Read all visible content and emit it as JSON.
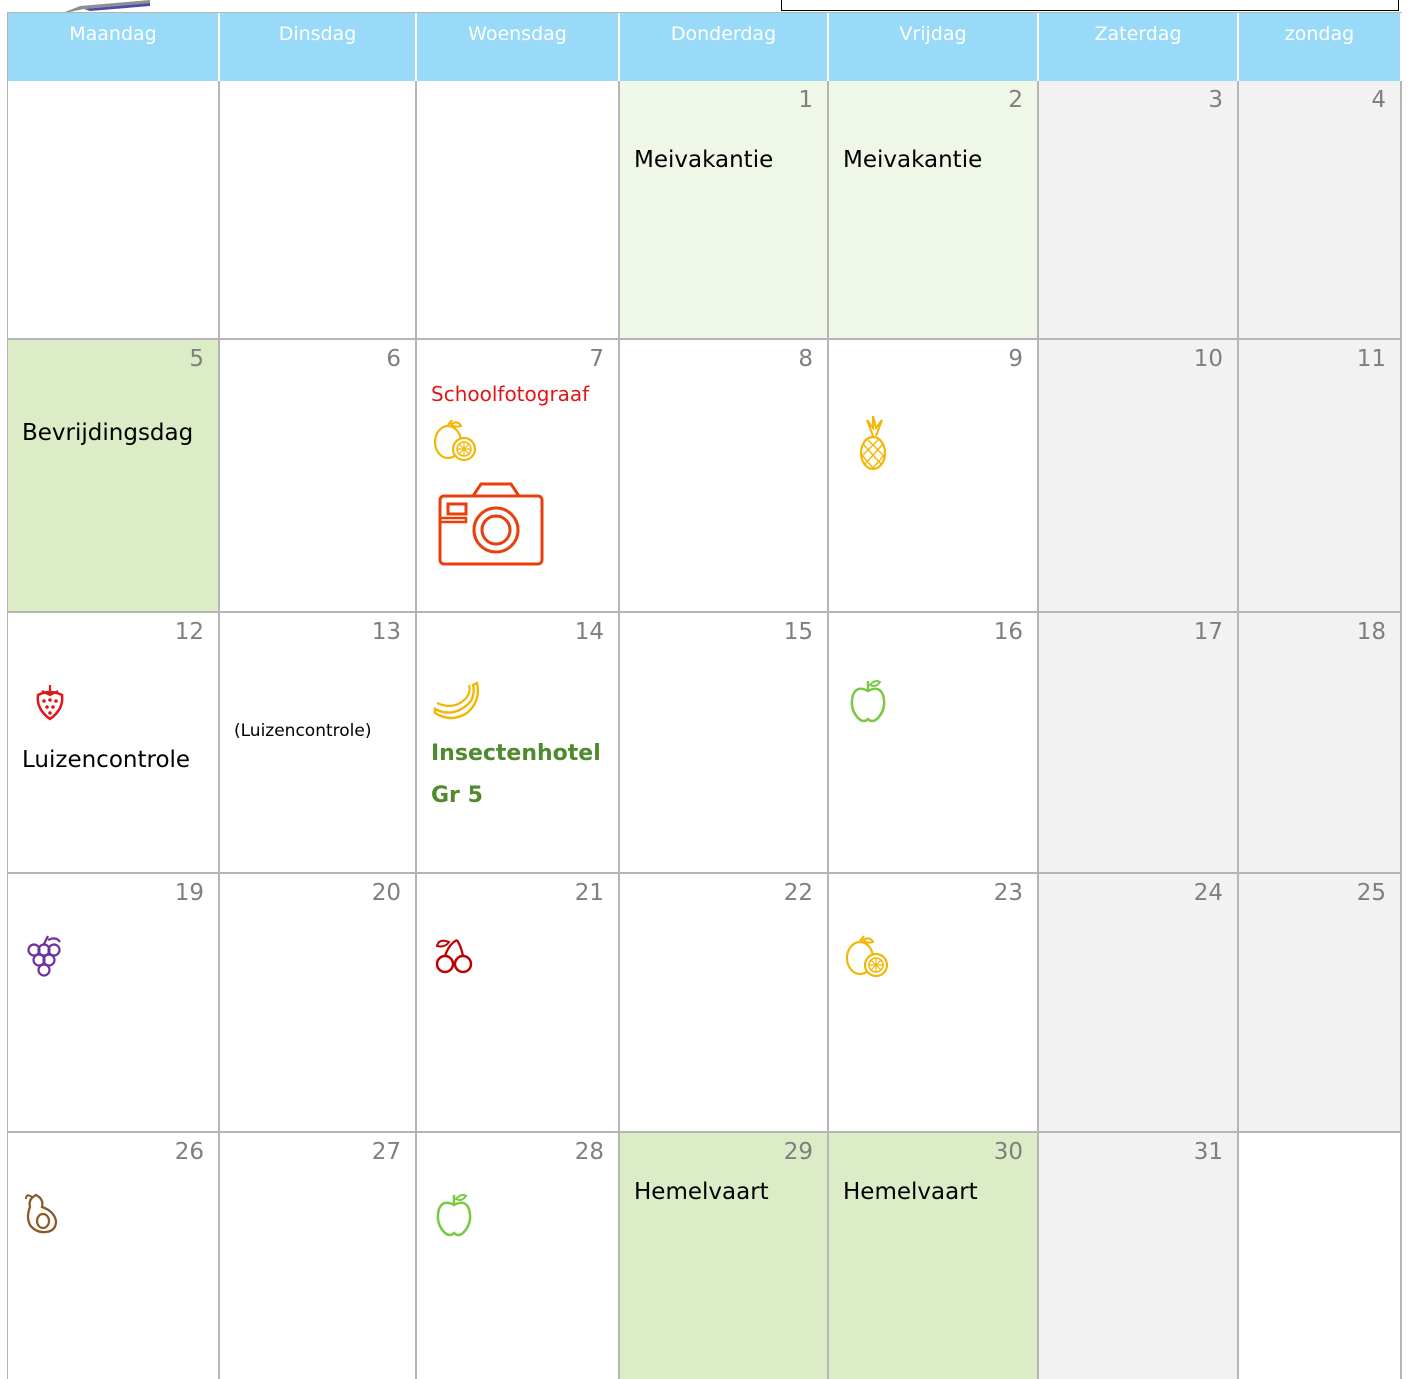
{
  "weekdays": [
    "Maandag",
    "Dinsdag",
    "Woensdag",
    "Donderdag",
    "Vrijdag",
    "Zaterdag",
    "zondag"
  ],
  "weeks": [
    [
      {
        "day": "",
        "type": "normal"
      },
      {
        "day": "",
        "type": "normal"
      },
      {
        "day": "",
        "type": "normal"
      },
      {
        "day": "1",
        "type": "vac-light",
        "events": [
          "Meivakantie"
        ]
      },
      {
        "day": "2",
        "type": "vac-light",
        "events": [
          "Meivakantie"
        ]
      },
      {
        "day": "3",
        "type": "weekend"
      },
      {
        "day": "4",
        "type": "weekend"
      }
    ],
    [
      {
        "day": "5",
        "type": "vac",
        "events": [
          "Bevrijdingsdag"
        ]
      },
      {
        "day": "6",
        "type": "normal"
      },
      {
        "day": "7",
        "type": "normal",
        "events": [
          "Schoolfotograaf"
        ],
        "icons": [
          "lemon-icon",
          "camera-icon"
        ]
      },
      {
        "day": "8",
        "type": "normal"
      },
      {
        "day": "9",
        "type": "normal",
        "icons": [
          "pineapple-icon"
        ]
      },
      {
        "day": "10",
        "type": "weekend"
      },
      {
        "day": "11",
        "type": "weekend"
      }
    ],
    [
      {
        "day": "12",
        "type": "normal",
        "events": [
          "Luizencontrole"
        ],
        "icons": [
          "strawberry-icon"
        ]
      },
      {
        "day": "13",
        "type": "normal",
        "events": [
          "(Luizencontrole)"
        ]
      },
      {
        "day": "14",
        "type": "normal",
        "events": [
          "Insectenhotel",
          "Gr 5"
        ],
        "icons": [
          "banana-icon"
        ]
      },
      {
        "day": "15",
        "type": "normal"
      },
      {
        "day": "16",
        "type": "normal",
        "icons": [
          "apple-icon"
        ]
      },
      {
        "day": "17",
        "type": "weekend"
      },
      {
        "day": "18",
        "type": "weekend"
      }
    ],
    [
      {
        "day": "19",
        "type": "normal",
        "icons": [
          "grapes-icon"
        ]
      },
      {
        "day": "20",
        "type": "normal"
      },
      {
        "day": "21",
        "type": "normal",
        "icons": [
          "cherry-icon"
        ]
      },
      {
        "day": "22",
        "type": "normal"
      },
      {
        "day": "23",
        "type": "normal",
        "icons": [
          "lemon-icon"
        ]
      },
      {
        "day": "24",
        "type": "weekend"
      },
      {
        "day": "25",
        "type": "weekend"
      }
    ],
    [
      {
        "day": "26",
        "type": "normal",
        "icons": [
          "avocado-icon"
        ]
      },
      {
        "day": "27",
        "type": "normal"
      },
      {
        "day": "28",
        "type": "normal",
        "icons": [
          "apple-icon"
        ]
      },
      {
        "day": "29",
        "type": "vac",
        "events": [
          "Hemelvaart"
        ]
      },
      {
        "day": "30",
        "type": "vac",
        "events": [
          "Hemelvaart"
        ]
      },
      {
        "day": "31",
        "type": "weekend"
      },
      {
        "day": "",
        "type": "normal"
      }
    ]
  ],
  "colors": {
    "header_bg": "#99daf8",
    "weekend_bg": "#f2f2f2",
    "vacation_bg": "#dbecc6",
    "vacation_light_bg": "#eef7e8",
    "event_red": "#e11717",
    "event_green": "#4f8a2f"
  }
}
